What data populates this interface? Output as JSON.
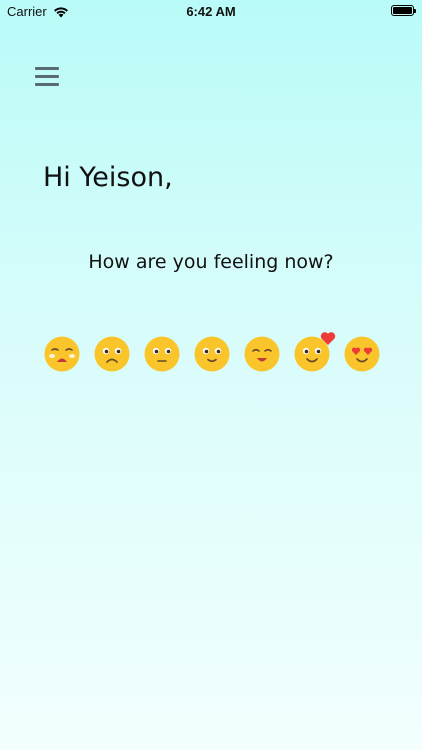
{
  "status_bar": {
    "carrier": "Carrier",
    "time": "6:42 AM",
    "battery_level": 1.0
  },
  "header": {
    "menu_icon": "hamburger-menu-icon"
  },
  "greeting": "Hi Yeison,",
  "question": "How are you feeling now?",
  "moods": [
    {
      "icon": "crying-face-icon"
    },
    {
      "icon": "frowning-face-icon"
    },
    {
      "icon": "neutral-face-icon"
    },
    {
      "icon": "slightly-smiling-face-icon"
    },
    {
      "icon": "happy-face-icon"
    },
    {
      "icon": "smiling-face-with-heart-icon"
    },
    {
      "icon": "heart-eyes-face-icon"
    }
  ],
  "colors": {
    "face": "#f9c52a",
    "face_shade": "#f0b41c",
    "heart": "#ef3b36",
    "menu": "#5b6b74",
    "background_top": "#b9fbf8",
    "background_bottom": "#f2fffe"
  }
}
